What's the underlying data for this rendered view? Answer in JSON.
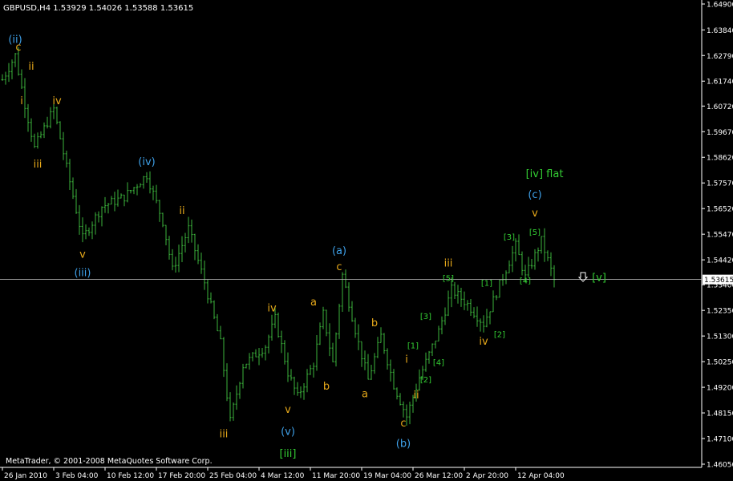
{
  "window": {
    "title": "GBPUSD,H4  1.53929 1.54026 1.53588 1.53615",
    "copyright": "MetaTrader, © 2001-2008 MetaQuotes Software Corp."
  },
  "colors": {
    "background": "#000000",
    "bars": "#3cb33c",
    "axis_text": "#ffffff",
    "grid": "#1a1a1a",
    "current_price_line": "#c0c0c0",
    "orange_label": "#e6a81a",
    "blue_label": "#3ea0e8",
    "green_label": "#33cc33"
  },
  "chart_data": {
    "type": "ohlc",
    "symbol": "GBPUSD",
    "timeframe": "H4",
    "last_bar": {
      "open": 1.53929,
      "high": 1.54026,
      "low": 1.53588,
      "close": 1.53615
    },
    "current_price": 1.53615,
    "current_price_label": "1.53615",
    "ylim": [
      1.46,
      1.65
    ],
    "y_ticks": [
      {
        "v": 1.649,
        "label": "1.64900"
      },
      {
        "v": 1.6384,
        "label": "1.63840"
      },
      {
        "v": 1.6279,
        "label": "1.62790"
      },
      {
        "v": 1.6174,
        "label": "1.61740"
      },
      {
        "v": 1.6072,
        "label": "1.60720"
      },
      {
        "v": 1.5967,
        "label": "1.59670"
      },
      {
        "v": 1.5862,
        "label": "1.58620"
      },
      {
        "v": 1.5757,
        "label": "1.57570"
      },
      {
        "v": 1.5652,
        "label": "1.56520"
      },
      {
        "v": 1.5547,
        "label": "1.55470"
      },
      {
        "v": 1.5442,
        "label": "1.54420"
      },
      {
        "v": 1.534,
        "label": "1.53400"
      },
      {
        "v": 1.5235,
        "label": "1.52350"
      },
      {
        "v": 1.513,
        "label": "1.51300"
      },
      {
        "v": 1.5025,
        "label": "1.50250"
      },
      {
        "v": 1.492,
        "label": "1.49200"
      },
      {
        "v": 1.4815,
        "label": "1.48150"
      },
      {
        "v": 1.471,
        "label": "1.47100"
      },
      {
        "v": 1.4605,
        "label": "1.46050"
      }
    ],
    "x_ticks": [
      {
        "i": 0,
        "label": "26 Jan 2010"
      },
      {
        "i": 16,
        "label": "3 Feb 04:00"
      },
      {
        "i": 32,
        "label": "10 Feb 12:00"
      },
      {
        "i": 48,
        "label": "17 Feb 20:00"
      },
      {
        "i": 64,
        "label": "25 Feb 04:00"
      },
      {
        "i": 80,
        "label": "4 Mar 12:00"
      },
      {
        "i": 96,
        "label": "11 Mar 20:00"
      },
      {
        "i": 112,
        "label": "19 Mar 04:00"
      },
      {
        "i": 128,
        "label": "26 Mar 12:00"
      },
      {
        "i": 144,
        "label": "2 Apr 20:00"
      },
      {
        "i": 160,
        "label": "12 Apr 04:00"
      }
    ],
    "price_path": [
      [
        0,
        1.618
      ],
      [
        4,
        1.628
      ],
      [
        7,
        1.608
      ],
      [
        10,
        1.59
      ],
      [
        16,
        1.606
      ],
      [
        20,
        1.582
      ],
      [
        25,
        1.553
      ],
      [
        31,
        1.566
      ],
      [
        38,
        1.57
      ],
      [
        45,
        1.579
      ],
      [
        50,
        1.56
      ],
      [
        53,
        1.54
      ],
      [
        58,
        1.557
      ],
      [
        63,
        1.535
      ],
      [
        68,
        1.51
      ],
      [
        71,
        1.478
      ],
      [
        75,
        1.501
      ],
      [
        82,
        1.509
      ],
      [
        85,
        1.52
      ],
      [
        89,
        1.498
      ],
      [
        92,
        1.488
      ],
      [
        97,
        1.502
      ],
      [
        100,
        1.522
      ],
      [
        103,
        1.502
      ],
      [
        106,
        1.538
      ],
      [
        111,
        1.51
      ],
      [
        114,
        1.495
      ],
      [
        118,
        1.513
      ],
      [
        122,
        1.493
      ],
      [
        126,
        1.48
      ],
      [
        130,
        1.496
      ],
      [
        136,
        1.515
      ],
      [
        140,
        1.532
      ],
      [
        145,
        1.526
      ],
      [
        150,
        1.518
      ],
      [
        155,
        1.534
      ],
      [
        160,
        1.55
      ],
      [
        163,
        1.537
      ],
      [
        168,
        1.552
      ],
      [
        172,
        1.536
      ]
    ],
    "wave_labels": [
      {
        "i": 4,
        "v": 1.633,
        "text": "(ii)",
        "color": "blue"
      },
      {
        "i": 5,
        "v": 1.63,
        "text": "c",
        "color": "orange"
      },
      {
        "i": 9,
        "v": 1.622,
        "text": "ii",
        "color": "orange"
      },
      {
        "i": 6,
        "v": 1.608,
        "text": "i",
        "color": "orange"
      },
      {
        "i": 17,
        "v": 1.608,
        "text": "iv",
        "color": "orange"
      },
      {
        "i": 11,
        "v": 1.582,
        "text": "iii",
        "color": "orange"
      },
      {
        "i": 45,
        "v": 1.583,
        "text": "(iv)",
        "color": "blue"
      },
      {
        "i": 56,
        "v": 1.563,
        "text": "ii",
        "color": "orange"
      },
      {
        "i": 25,
        "v": 1.545,
        "text": "v",
        "color": "orange"
      },
      {
        "i": 25,
        "v": 1.5375,
        "text": "(iii)",
        "color": "blue"
      },
      {
        "i": 69,
        "v": 1.4715,
        "text": "iii",
        "color": "orange"
      },
      {
        "i": 84,
        "v": 1.523,
        "text": "iv",
        "color": "orange"
      },
      {
        "i": 89,
        "v": 1.4815,
        "text": "v",
        "color": "orange"
      },
      {
        "i": 89,
        "v": 1.4725,
        "text": "(v)",
        "color": "blue"
      },
      {
        "i": 89,
        "v": 1.4635,
        "text": "[iii]",
        "color": "green"
      },
      {
        "i": 97,
        "v": 1.5255,
        "text": "a",
        "color": "orange"
      },
      {
        "i": 101,
        "v": 1.491,
        "text": "b",
        "color": "orange"
      },
      {
        "i": 105,
        "v": 1.5465,
        "text": "(a)",
        "color": "blue"
      },
      {
        "i": 105,
        "v": 1.54,
        "text": "c",
        "color": "orange"
      },
      {
        "i": 116,
        "v": 1.517,
        "text": "b",
        "color": "orange"
      },
      {
        "i": 113,
        "v": 1.488,
        "text": "a",
        "color": "orange"
      },
      {
        "i": 125,
        "v": 1.476,
        "text": "c",
        "color": "orange"
      },
      {
        "i": 125,
        "v": 1.4675,
        "text": "(b)",
        "color": "blue"
      },
      {
        "i": 126,
        "v": 1.502,
        "text": "i",
        "color": "orange"
      },
      {
        "i": 128,
        "v": 1.508,
        "text": "[1]",
        "color": "green"
      },
      {
        "i": 129,
        "v": 1.4875,
        "text": "ii",
        "color": "orange"
      },
      {
        "i": 132,
        "v": 1.494,
        "text": "[2]",
        "color": "green"
      },
      {
        "i": 132,
        "v": 1.52,
        "text": "[3]",
        "color": "green"
      },
      {
        "i": 136,
        "v": 1.501,
        "text": "[4]",
        "color": "green"
      },
      {
        "i": 139,
        "v": 1.5415,
        "text": "iii",
        "color": "orange"
      },
      {
        "i": 139,
        "v": 1.5355,
        "text": "[5]",
        "color": "green"
      },
      {
        "i": 151,
        "v": 1.5335,
        "text": "[1]",
        "color": "green"
      },
      {
        "i": 150,
        "v": 1.5095,
        "text": "iv",
        "color": "orange"
      },
      {
        "i": 155,
        "v": 1.5125,
        "text": "[2]",
        "color": "green"
      },
      {
        "i": 158,
        "v": 1.5525,
        "text": "[3]",
        "color": "green"
      },
      {
        "i": 163,
        "v": 1.5345,
        "text": "[4]",
        "color": "green"
      },
      {
        "i": 166,
        "v": 1.5545,
        "text": "[5]",
        "color": "green"
      },
      {
        "i": 166,
        "v": 1.562,
        "text": "v",
        "color": "orange"
      },
      {
        "i": 166,
        "v": 1.5695,
        "text": "(c)",
        "color": "blue"
      },
      {
        "i": 169,
        "v": 1.578,
        "text": "[iv] flat",
        "color": "green"
      },
      {
        "i": 186,
        "v": 1.5355,
        "text": "[v]",
        "color": "green"
      }
    ],
    "arrow_marker": {
      "i": 181,
      "v": 1.537
    }
  }
}
